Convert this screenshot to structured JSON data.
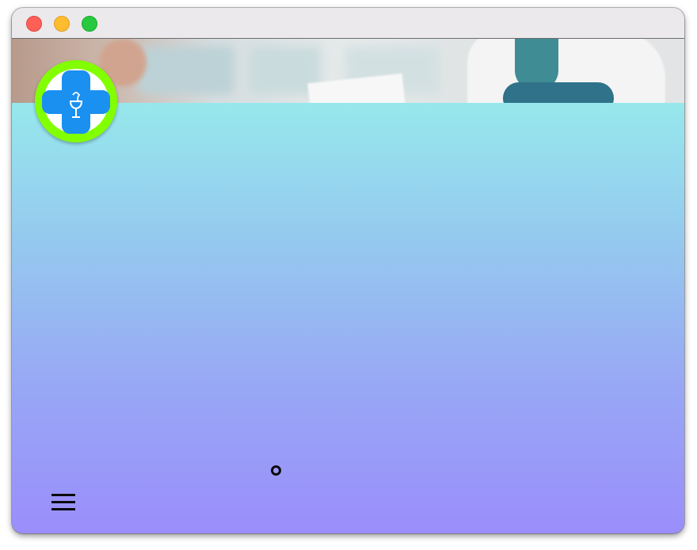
{
  "window": {
    "controls": [
      "close",
      "minimize",
      "maximize"
    ]
  },
  "header": {
    "hero_image": "pharmacist-at-pharmacy-counter",
    "logo_icon": "pharmacy-cross-icon"
  },
  "colors": {
    "titlebar": "#ebe9ec",
    "logo_ring": "#82ff00",
    "logo_cross": "#1a90f0",
    "gradient_top": "#96e8ec",
    "gradient_bottom": "#9a8efb",
    "close": "#fe5f57",
    "minimize": "#febc2e",
    "maximize": "#28c840"
  },
  "nav": {
    "menu_icon": "hamburger-menu-icon"
  },
  "status": {
    "indicator_icon": "loading-ring-icon"
  }
}
